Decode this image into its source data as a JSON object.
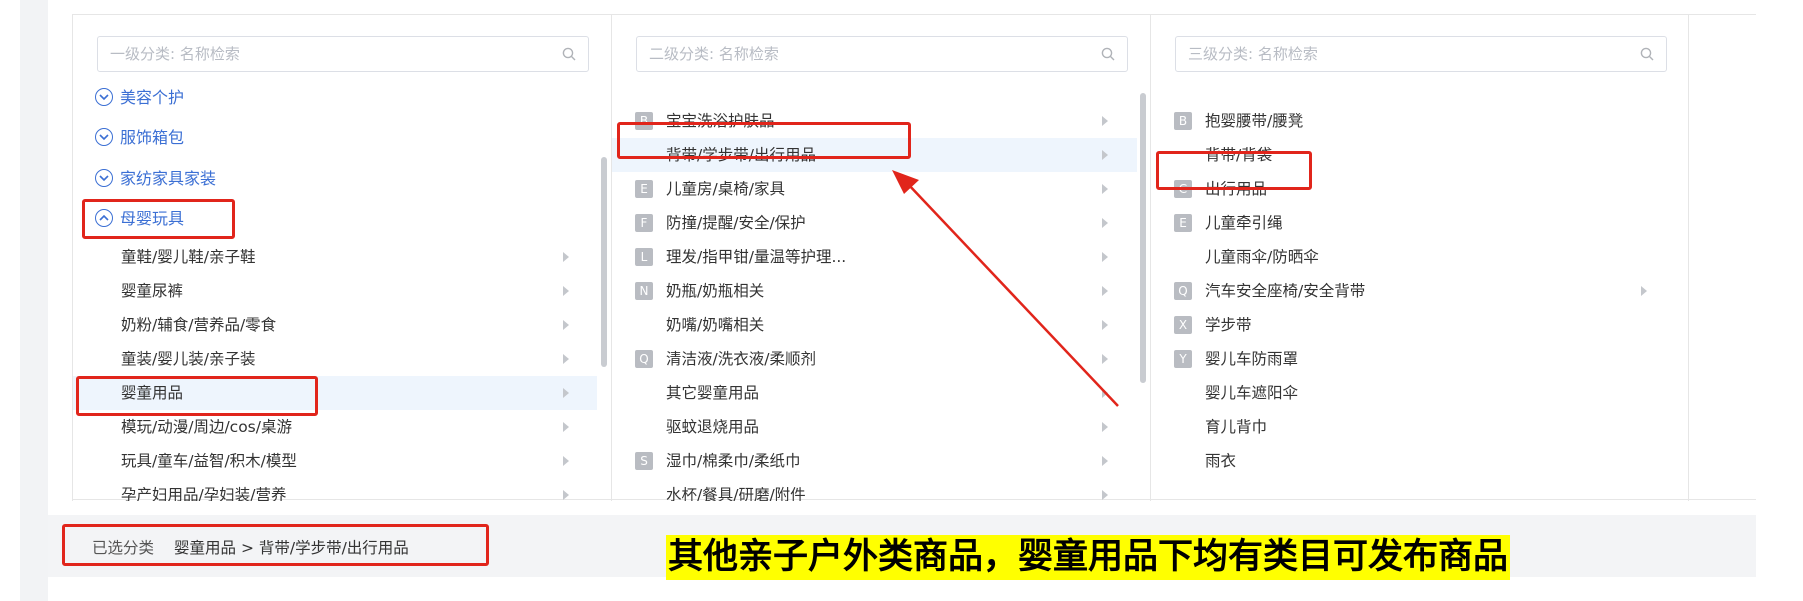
{
  "panel1": {
    "placeholder": "一级分类: 名称检索",
    "groups": [
      "美容个护",
      "服饰箱包",
      "家纺家具家装",
      "母婴玩具"
    ],
    "items": [
      "童鞋/婴儿鞋/亲子鞋",
      "婴童尿裤",
      "奶粉/辅食/营养品/零食",
      "童装/婴儿装/亲子装",
      "婴童用品",
      "模玩/动漫/周边/cos/桌游",
      "玩具/童车/益智/积木/模型",
      "孕产妇用品/孕妇装/营养"
    ]
  },
  "panel2": {
    "placeholder": "二级分类: 名称检索",
    "letters": [
      "B",
      "E",
      "F",
      "L",
      "N",
      "Q",
      "S"
    ],
    "items": [
      "宝宝洗浴护肤品",
      "背带/学步带/出行用品",
      "儿童房/桌椅/家具",
      "防撞/提醒/安全/保护",
      "理发/指甲钳/量温等护理...",
      "奶瓶/奶瓶相关",
      "奶嘴/奶嘴相关",
      "清洁液/洗衣液/柔顺剂",
      "其它婴童用品",
      "驱蚊退烧用品",
      "湿巾/棉柔巾/柔纸巾",
      "水杯/餐具/研磨/附件"
    ]
  },
  "panel3": {
    "placeholder": "三级分类: 名称检索",
    "letters": [
      "B",
      "C",
      "E",
      "Q",
      "X",
      "Y"
    ],
    "items": [
      "抱婴腰带/腰凳",
      "背带/背袋",
      "出行用品",
      "儿童牵引绳",
      "儿童雨伞/防晒伞",
      "汽车安全座椅/安全背带",
      "学步带",
      "婴儿车防雨罩",
      "婴儿车遮阳伞",
      "育儿背巾",
      "雨衣"
    ]
  },
  "footer": {
    "label": "已选分类",
    "path": "婴童用品 > 背带/学步带/出行用品"
  },
  "annotation": {
    "banner": "其他亲子户外类商品，婴童用品下均有类目可发布商品"
  },
  "icons": {
    "search": "search-icon",
    "group_collapsed": "circle-chevron-down-icon",
    "group_expanded": "circle-chevron-up-icon",
    "row_arrow": "chevron-right-icon"
  },
  "colors": {
    "link_blue": "#3b6fd4",
    "highlight_red": "#e1251b",
    "selected_row_bg": "#eef5fd",
    "banner_yellow": "#ffff00"
  }
}
